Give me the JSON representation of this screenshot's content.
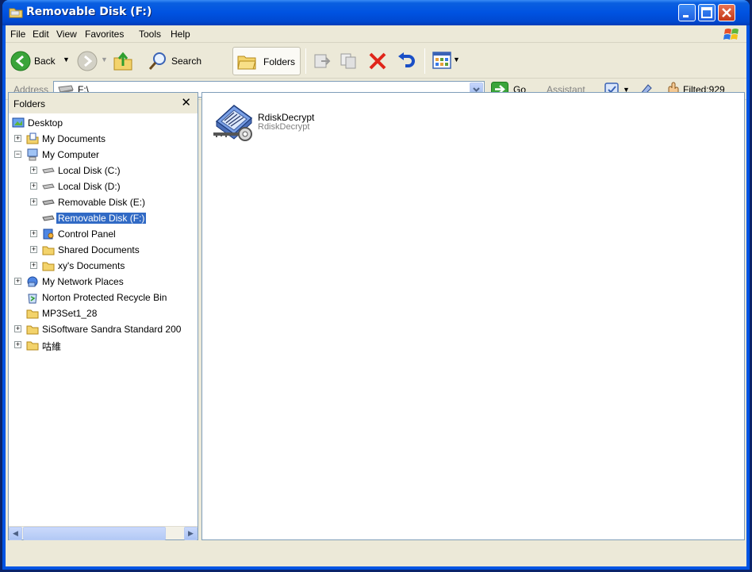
{
  "window": {
    "title": "Removable Disk (F:)"
  },
  "menu": [
    "File",
    "Edit",
    "View",
    "Favorites",
    "Tools",
    "Help"
  ],
  "toolbar": {
    "back_label": "Back",
    "search_label": "Search",
    "folders_label": "Folders"
  },
  "address": {
    "label": "Address",
    "value": "F:\\",
    "go_label": "Go",
    "assistant_label": "Assistant",
    "filted_label": "Filted:929"
  },
  "folders_pane": {
    "title": "Folders",
    "close_glyph": "✕",
    "items": [
      {
        "label": "Desktop",
        "icon": "desktop-icon"
      },
      {
        "label": "My Documents",
        "icon": "my-documents-icon"
      },
      {
        "label": "My Computer",
        "icon": "my-computer-icon"
      },
      {
        "label": "Local Disk (C:)",
        "icon": "drive-icon"
      },
      {
        "label": "Local Disk (D:)",
        "icon": "drive-icon"
      },
      {
        "label": "Removable Disk (E:)",
        "icon": "removable-drive-icon"
      },
      {
        "label": "Removable Disk (F:)",
        "icon": "removable-drive-icon"
      },
      {
        "label": "Control Panel",
        "icon": "control-panel-icon"
      },
      {
        "label": "Shared Documents",
        "icon": "folder-icon"
      },
      {
        "label": "xy's Documents",
        "icon": "folder-icon"
      },
      {
        "label": "My Network Places",
        "icon": "network-places-icon"
      },
      {
        "label": "Norton Protected Recycle Bin",
        "icon": "recycle-bin-icon"
      },
      {
        "label": "MP3Set1_28",
        "icon": "folder-icon"
      },
      {
        "label": "SiSoftware Sandra Standard 200",
        "icon": "folder-icon"
      },
      {
        "label": "咕維",
        "icon": "folder-icon"
      }
    ]
  },
  "files": [
    {
      "name": "RdiskDecrypt",
      "description": "RdiskDecrypt",
      "icon": "encrypted-disk-key-icon"
    }
  ]
}
